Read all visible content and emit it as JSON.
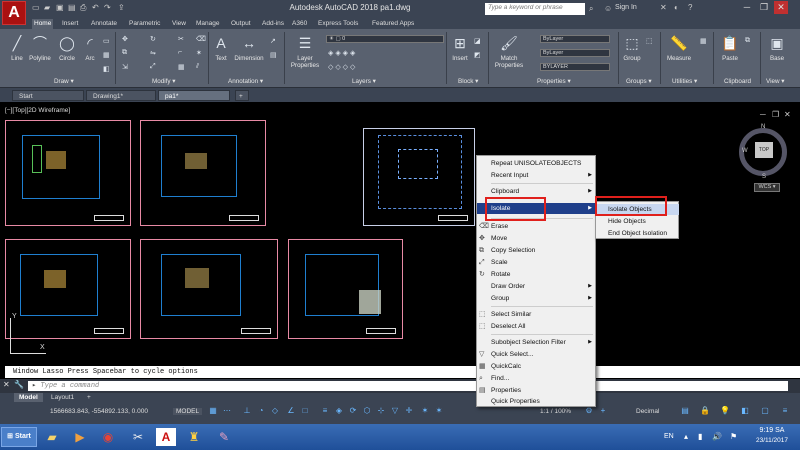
{
  "title_bar": {
    "app_letter": "A",
    "title": "Autodesk AutoCAD 2018    pa1.dwg",
    "search_placeholder": "Type a keyword or phrase",
    "sign_in": "Sign In",
    "minimize": "─",
    "restore": "❐",
    "close": "✕"
  },
  "ribbon_tabs": [
    "Home",
    "Insert",
    "Annotate",
    "Parametric",
    "View",
    "Manage",
    "Output",
    "Add-ins",
    "A360",
    "Express Tools",
    "Featured Apps"
  ],
  "ribbon": {
    "draw_tools": [
      "Line",
      "Polyline",
      "Circle",
      "Arc"
    ],
    "text_tool": "Text",
    "dimension_tool": "Dimension",
    "layer_properties": "Layer\nProperties",
    "insert_tool": "Insert",
    "match_properties": "Match\nProperties",
    "group_tool": "Group",
    "measure_tool": "Measure",
    "paste_tool": "Paste",
    "base_tool": "Base",
    "bylayer_1": "ByLayer",
    "bylayer_2": "ByLayer",
    "bylayer_3": "BYLAYER",
    "panels": {
      "draw": "Draw ▾",
      "modify": "Modify ▾",
      "annotation": "Annotation ▾",
      "layers": "Layers ▾",
      "block": "Block ▾",
      "properties": "Properties ▾",
      "groups": "Groups ▾",
      "utilities": "Utilities ▾",
      "clipboard": "Clipboard",
      "view": "View ▾"
    }
  },
  "file_tabs": [
    "Start",
    "Drawing1*",
    "pa1*"
  ],
  "file_tab_add": "+",
  "viewport_label": "[−][Top][2D Wireframe]",
  "viewcube": {
    "top": "TOP",
    "n": "N",
    "s": "S",
    "w": "W",
    "wcs": "WCS ▾"
  },
  "command": {
    "history": "Window Lasso  Press Spacebar to cycle options",
    "placeholder": "Type a command"
  },
  "layout_tabs": [
    "Model",
    "Layout1"
  ],
  "layout_add": "+",
  "status": {
    "coords": "1566683.843, -554892.133, 0.000",
    "mode": "MODEL",
    "scale": "1:1 / 100%",
    "units": "Decimal"
  },
  "taskbar": {
    "start": "Start",
    "lang": "EN",
    "time": "9:19 SA",
    "date": "23/11/2017"
  },
  "context_menu": [
    {
      "label": "Repeat UNISOLATEOBJECTS",
      "arrow": ""
    },
    {
      "label": "Recent Input",
      "arrow": "▶"
    },
    {
      "label": "Clipboard",
      "arrow": "▶"
    },
    {
      "label": "Isolate",
      "arrow": "▶"
    },
    {
      "label": "Erase",
      "arrow": ""
    },
    {
      "label": "Move",
      "arrow": ""
    },
    {
      "label": "Copy Selection",
      "arrow": ""
    },
    {
      "label": "Scale",
      "arrow": ""
    },
    {
      "label": "Rotate",
      "arrow": ""
    },
    {
      "label": "Draw Order",
      "arrow": "▶"
    },
    {
      "label": "Group",
      "arrow": "▶"
    },
    {
      "label": "Select Similar",
      "arrow": ""
    },
    {
      "label": "Deselect All",
      "arrow": ""
    },
    {
      "label": "Subobject Selection Filter",
      "arrow": "▶"
    },
    {
      "label": "Quick Select...",
      "arrow": ""
    },
    {
      "label": "QuickCalc",
      "arrow": ""
    },
    {
      "label": "Find...",
      "arrow": ""
    },
    {
      "label": "Properties",
      "arrow": ""
    },
    {
      "label": "Quick Properties",
      "arrow": ""
    }
  ],
  "submenu": [
    "Isolate Objects",
    "Hide Objects",
    "End Object Isolation"
  ]
}
